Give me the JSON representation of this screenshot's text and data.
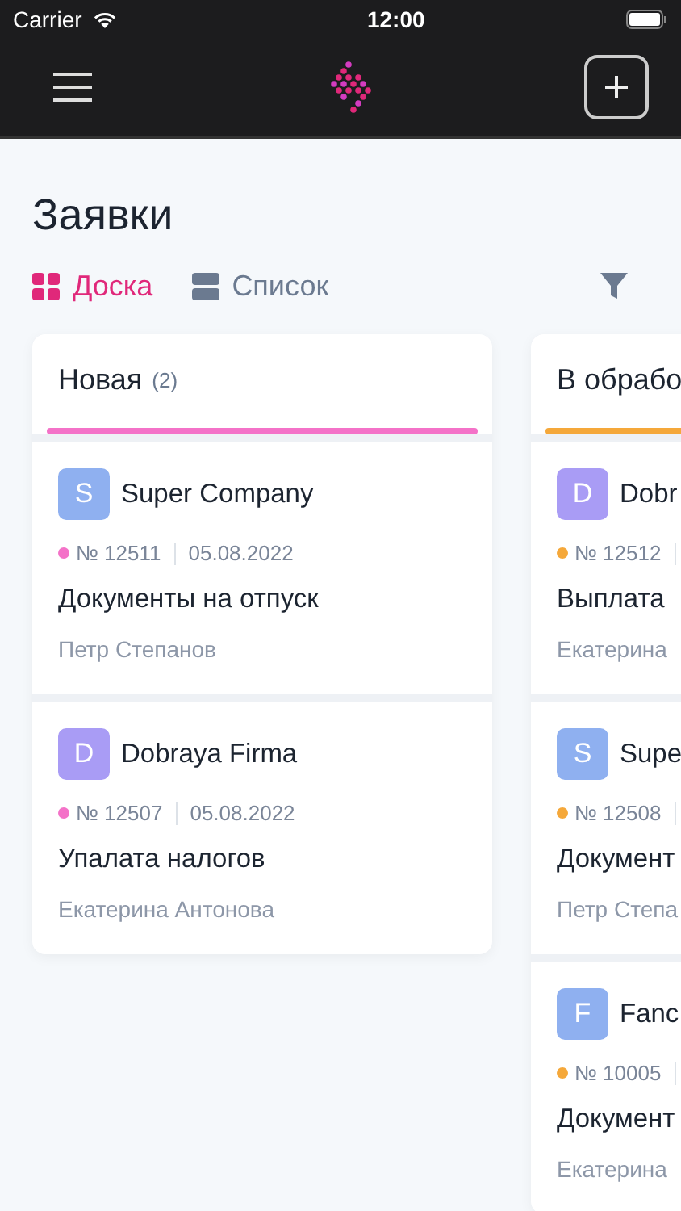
{
  "status_bar": {
    "carrier": "Carrier",
    "time": "12:00"
  },
  "page_title": "Заявки",
  "view_tabs": [
    {
      "label": "Доска",
      "kind": "board",
      "selected": true
    },
    {
      "label": "Список",
      "kind": "list",
      "selected": false
    }
  ],
  "columns": [
    {
      "title": "Новая",
      "count": "(2)",
      "color": "#f472c8",
      "cards": [
        {
          "avatar": {
            "letter": "S",
            "color": "#8fb0f0"
          },
          "company": "Super Company",
          "number": "№ 12511",
          "date": "05.08.2022",
          "title": "Документы на отпуск",
          "assignee": "Петр Степанов",
          "color": "#f472c8"
        },
        {
          "avatar": {
            "letter": "D",
            "color": "#a99cf5"
          },
          "company": "Dobraya Firma",
          "number": "№ 12507",
          "date": "05.08.2022",
          "title": "Упалата налогов",
          "assignee": "Екатерина Антонова",
          "color": "#f472c8"
        }
      ]
    },
    {
      "title": "В обрабо",
      "color": "#f5a83a",
      "cards": [
        {
          "avatar": {
            "letter": "D",
            "color": "#a99cf5"
          },
          "company": "Dobr",
          "number": "№ 12512",
          "title": "Выплата",
          "assignee": "Екатерина",
          "color": "#f5a83a"
        },
        {
          "avatar": {
            "letter": "S",
            "color": "#8fb0f0"
          },
          "company": "Supe",
          "number": "№ 12508",
          "title": "Документ",
          "assignee": "Петр Степа",
          "color": "#f5a83a"
        },
        {
          "avatar": {
            "letter": "F",
            "color": "#8fb0f0"
          },
          "company": "Fanc",
          "number": "№ 10005",
          "title": "Документ",
          "assignee": "Екатерина",
          "color": "#f5a83a"
        }
      ]
    }
  ]
}
